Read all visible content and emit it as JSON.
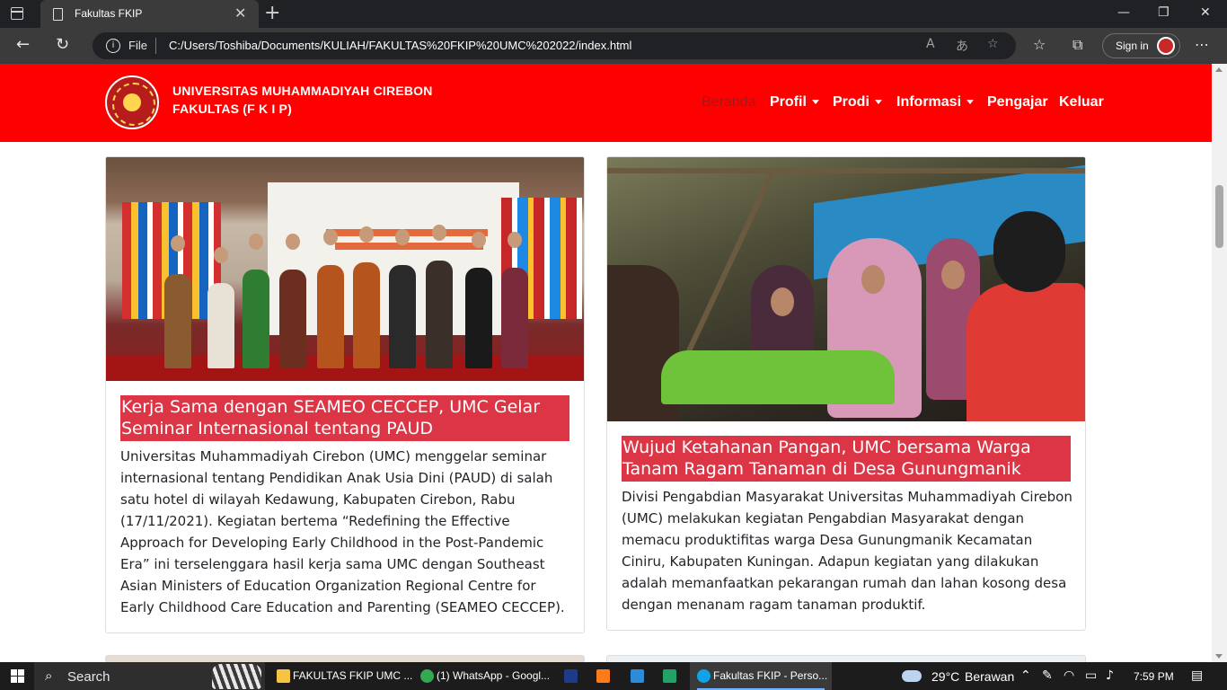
{
  "browser": {
    "tab_title": "Fakultas FKIP",
    "tab_close": "✕",
    "new_tab": "+",
    "url_scheme_label": "File",
    "url": "C:/Users/Toshiba/Documents/KULIAH/FAKULTAS%20FKIP%20UMC%202022/index.html",
    "sign_in_label": "Sign in",
    "more_menu": "⋯",
    "minimize": "—",
    "maximize": "❐",
    "close": "✕",
    "back": "←",
    "refresh": "↻",
    "info_glyph": "i",
    "read_aloud": "A",
    "translate": "あ",
    "favorites_add": "☆",
    "favorites": "☆",
    "collections": "⧉"
  },
  "site": {
    "brand_line1": "UNIVERSITAS MUHAMMADIYAH CIREBON",
    "brand_line2": "FAKULTAS (F K I P)",
    "nav": {
      "home": "Beranda",
      "profile": "Profil",
      "programs": "Prodi",
      "info": "Informasi",
      "teachers": "Pengajar",
      "logout": "Keluar"
    },
    "accent_color": "#ff0000",
    "title_bg_color": "#dc3545"
  },
  "cards": [
    {
      "title": "Kerja Sama dengan SEAMEO CECCEP, UMC Gelar Seminar Internasional tentang PAUD",
      "text": "Universitas Muhammadiyah Cirebon (UMC) menggelar seminar internasional tentang Pendidikan Anak Usia Dini (PAUD) di salah satu hotel di wilayah Kedawung, Kabupaten Cirebon, Rabu (17/11/2021). Kegiatan bertema “Redefining the Effective Approach for Developing Early Childhood in the Post-Pandemic Era” ini terselenggara hasil kerja sama UMC dengan Southeast Asian Ministers of Education Organization Regional Centre for Early Childhood Care Education and Parenting (SEAMEO CECCEP)."
    },
    {
      "title": "Wujud Ketahanan Pangan, UMC bersama Warga Tanam Ragam Tanaman di Desa Gunungmanik",
      "text": "Divisi Pengabdian Masyarakat Universitas Muhammadiyah Cirebon (UMC) melakukan kegiatan Pengabdian Masyarakat dengan memacu produktifitas warga Desa Gunungmanik Kecamatan Ciniru, Kabupaten Kuningan. Adapun kegiatan yang dilakukan adalah memanfaatkan pekarangan rumah dan lahan kosong desa dengan menanam ragam tanaman produktif."
    }
  ],
  "taskbar": {
    "search_label": "Search",
    "tasks": [
      {
        "label": "FAKULTAS FKIP UMC ...",
        "icon_color": "#f6c344"
      },
      {
        "label": "(1) WhatsApp - Googl...",
        "icon_color": "#34a853"
      },
      {
        "label": "",
        "icon_color": "#1e3a8a"
      },
      {
        "label": "",
        "icon_color": "#ff7a1a"
      },
      {
        "label": "",
        "icon_color": "#2d8cd9"
      },
      {
        "label": "",
        "icon_color": "#21a366"
      },
      {
        "label": "Fakultas FKIP - Perso...",
        "icon_color": "#0fa4e8"
      }
    ],
    "weather_temp": "29°C",
    "weather_desc": "Berawan",
    "time": "7:59 PM"
  }
}
